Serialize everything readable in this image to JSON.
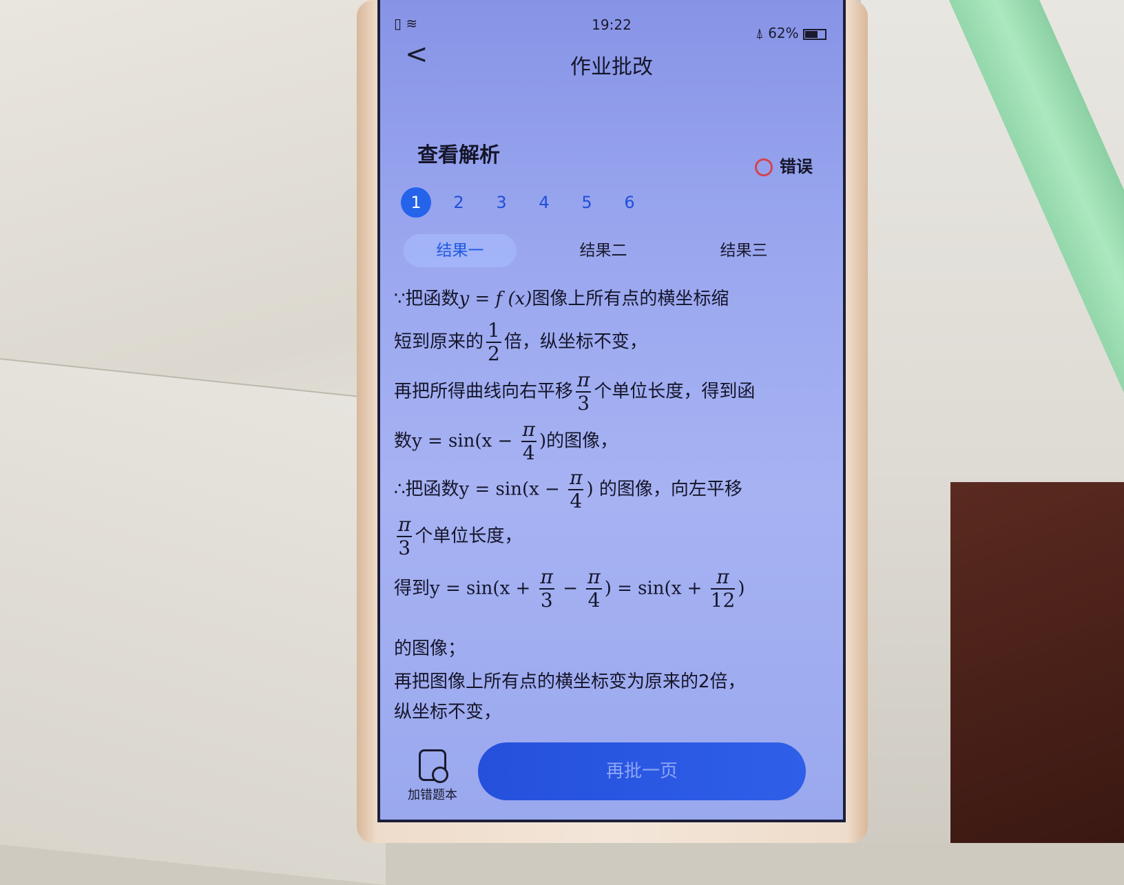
{
  "status_bar": {
    "time": "19:22",
    "battery": "62%"
  },
  "header": {
    "title": "作业批改"
  },
  "section": {
    "title": "查看解析",
    "result_label": "错误"
  },
  "questions": [
    "1",
    "2",
    "3",
    "4",
    "5",
    "6"
  ],
  "tabs": [
    "结果一",
    "结果二",
    "结果三"
  ],
  "solution": {
    "l1a": "∵把函数",
    "l1m": "y = f (x)",
    "l1b": "图像上所有点的横坐标缩",
    "l2a": "短到原来的",
    "l2n": "1",
    "l2d": "2",
    "l2b": "倍，纵坐标不变，",
    "l3a": "再把所得曲线向右平移",
    "l3n": "π",
    "l3d": "3",
    "l3b": "个单位长度，得到函",
    "l4a": "数",
    "l4m1": "y = sin(x − ",
    "l4n": "π",
    "l4d": "4",
    "l4m2": ")",
    "l4b": "的图像，",
    "l5a": "∴把函数",
    "l5m1": "y = sin(x − ",
    "l5n": "π",
    "l5d": "4",
    "l5m2": ")",
    "l5b": " 的图像，向左平移",
    "l6n": "π",
    "l6d": "3",
    "l6b": "个单位长度，",
    "l7a": "得到",
    "l7m1": "y = sin(x + ",
    "l7n1": "π",
    "l7d1": "3",
    "l7m2": " − ",
    "l7n2": "π",
    "l7d2": "4",
    "l7m3": ") = sin(x + ",
    "l7n3": "π",
    "l7d3": "12",
    "l7m4": ")",
    "l8": "的图像；",
    "l9": "再把图像上所有点的横坐标变为原来的2倍，",
    "l10": "纵坐标不变，"
  },
  "bottom": {
    "add_mistake": "加错题本",
    "next_page": "再批一页"
  }
}
